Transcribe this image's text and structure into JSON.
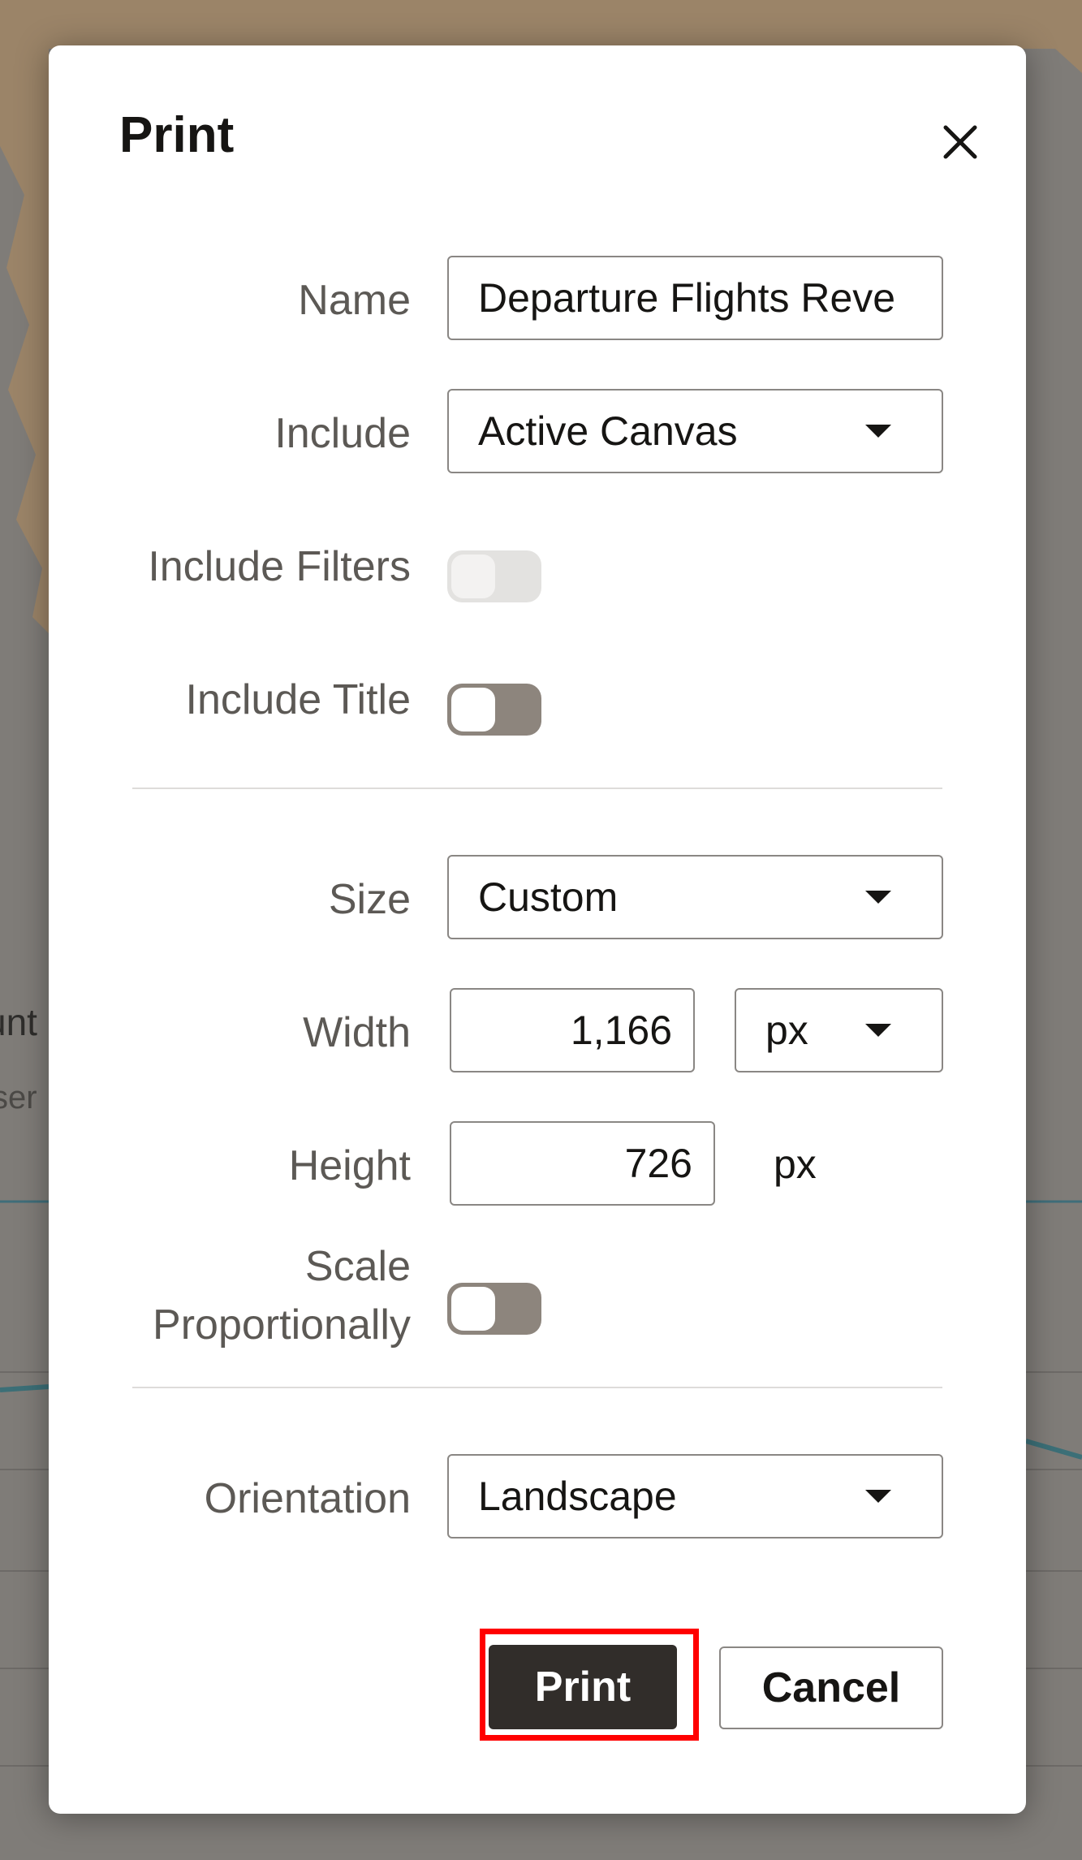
{
  "background": {
    "partial_text_1": "unt",
    "partial_text_2": "ser"
  },
  "dialog": {
    "title": "Print",
    "close_icon": "close-icon",
    "fields": {
      "name": {
        "label": "Name",
        "value": "Departure Flights Reve"
      },
      "include": {
        "label": "Include",
        "value": "Active Canvas"
      },
      "include_filters": {
        "label": "Include Filters",
        "state": "off",
        "disabled": true
      },
      "include_title": {
        "label": "Include Title",
        "state": "off"
      },
      "size": {
        "label": "Size",
        "value": "Custom"
      },
      "width": {
        "label": "Width",
        "value": "1,166",
        "unit": "px"
      },
      "height": {
        "label": "Height",
        "value": "726",
        "unit": "px"
      },
      "scale_proportionally": {
        "label_line1": "Scale",
        "label_line2": "Proportionally",
        "state": "off"
      },
      "orientation": {
        "label": "Orientation",
        "value": "Landscape"
      }
    },
    "buttons": {
      "print": "Print",
      "cancel": "Cancel"
    }
  },
  "colors": {
    "primary_button": "#312d2a",
    "toggle_off": "#8d857d",
    "highlight": "#ff0000"
  }
}
